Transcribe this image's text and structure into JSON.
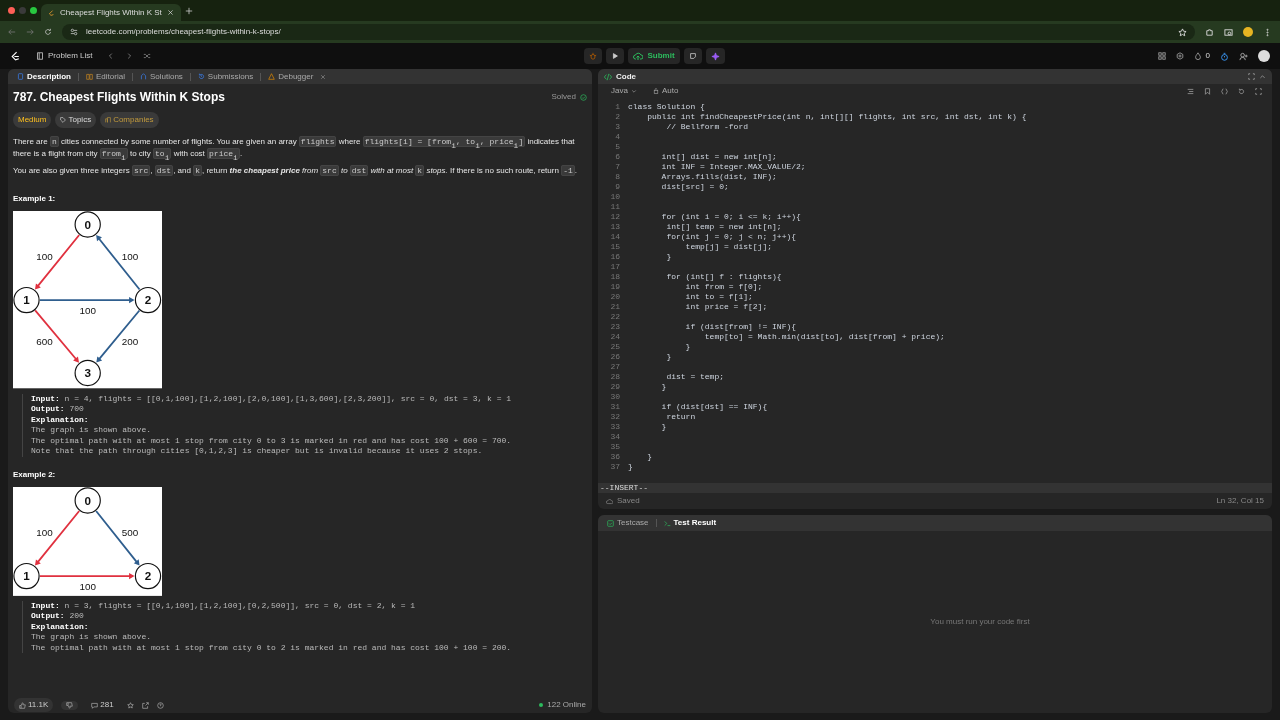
{
  "browser": {
    "tab_title": "Cheapest Flights Within K St",
    "url": "leetcode.com/problems/cheapest-flights-within-k-stops/"
  },
  "nav": {
    "problem_list": "Problem List",
    "submit": "Submit",
    "streak": "0"
  },
  "left_tabs": [
    {
      "label": "Description",
      "selected": true
    },
    {
      "label": "Editorial",
      "selected": false
    },
    {
      "label": "Solutions",
      "selected": false
    },
    {
      "label": "Submissions",
      "selected": false
    },
    {
      "label": "Debugger",
      "selected": false
    }
  ],
  "problem": {
    "title": "787. Cheapest Flights Within K Stops",
    "status": "Solved",
    "tags": [
      {
        "label": "Medium",
        "kind": "difficulty"
      },
      {
        "label": "Topics",
        "kind": "topics"
      },
      {
        "label": "Companies",
        "kind": "companies"
      }
    ],
    "paragraphs": [
      [
        {
          "kind": "text",
          "text": "There are "
        },
        {
          "kind": "code",
          "text": "n"
        },
        {
          "kind": "text",
          "text": " cities connected by some number of flights. You are given an array "
        },
        {
          "kind": "code",
          "text": "flights"
        },
        {
          "kind": "text",
          "text": " where "
        },
        {
          "kind": "code",
          "text": "flights[i] = [from$_{i}$, to$_{i}$, price$_{i}$]"
        },
        {
          "kind": "text",
          "text": " indicates that there is a flight from city "
        },
        {
          "kind": "code",
          "text": "from$_{i}$"
        },
        {
          "kind": "text",
          "text": " to city "
        },
        {
          "kind": "code",
          "text": "to$_{i}$"
        },
        {
          "kind": "text",
          "text": " with cost "
        },
        {
          "kind": "code",
          "text": "price$_{i}$"
        },
        {
          "kind": "text",
          "text": "."
        }
      ],
      [
        {
          "kind": "text",
          "text": "You are also given three integers "
        },
        {
          "kind": "code",
          "text": "src"
        },
        {
          "kind": "text",
          "text": ", "
        },
        {
          "kind": "code",
          "text": "dst"
        },
        {
          "kind": "text",
          "text": ", and "
        },
        {
          "kind": "code",
          "text": "k"
        },
        {
          "kind": "text",
          "text": ", return "
        },
        {
          "kind": "em",
          "text": "**the cheapest price** from "
        },
        {
          "kind": "code",
          "text": "src"
        },
        {
          "kind": "em",
          "text": " to "
        },
        {
          "kind": "code",
          "text": "dst"
        },
        {
          "kind": "em",
          "text": " with at most "
        },
        {
          "kind": "code",
          "text": "k"
        },
        {
          "kind": "em",
          "text": " stops."
        },
        {
          "kind": "text",
          "text": " If there is no such route, return "
        },
        {
          "kind": "code",
          "text": "-1"
        },
        {
          "kind": "text",
          "text": "."
        }
      ]
    ]
  },
  "examples": [
    {
      "heading": "Example 1:",
      "graph": {
        "kind": "diamond",
        "nodes": [
          "0",
          "1",
          "2",
          "3"
        ],
        "edges": [
          {
            "weight": "100",
            "color": "#e0313f"
          },
          {
            "weight": "100",
            "color": "#2f5e8e"
          },
          {
            "weight": "100",
            "color": "#2f5e8e"
          },
          {
            "weight": "600",
            "color": "#e0313f"
          },
          {
            "weight": "200",
            "color": "#2f5e8e"
          }
        ]
      },
      "lines": [
        "**Input:** n = 4, flights = [[0,1,100],[1,2,100],[2,0,100],[1,3,600],[2,3,200]], src = 0, dst = 3, k = 1",
        "**Output:** 700",
        "**Explanation:**",
        "The graph is shown above.",
        "The optimal path with at most 1 stop from city 0 to 3 is marked in red and has cost 100 + 600 = 700.",
        "Note that the path through cities [0,1,2,3] is cheaper but is invalid because it uses 2 stops."
      ]
    },
    {
      "heading": "Example 2:",
      "graph": {
        "kind": "triangle",
        "nodes": [
          "0",
          "1",
          "2"
        ],
        "edges": [
          {
            "weight": "100",
            "color": "#e0313f"
          },
          {
            "weight": "500",
            "color": "#2f5e8e"
          },
          {
            "weight": "100",
            "color": "#e0313f"
          }
        ]
      },
      "lines": [
        "**Input:** n = 3, flights = [[0,1,100],[1,2,100],[0,2,500]], src = 0, dst = 2, k = 1",
        "**Output:** 200",
        "**Explanation:**",
        "The graph is shown above.",
        "The optimal path with at most 1 stop from city 0 to 2 is marked in red and has cost 100 + 100 = 200."
      ]
    }
  ],
  "footer": {
    "likes": "11.1K",
    "comments": "281",
    "online": "122 Online"
  },
  "editor": {
    "title": "Code",
    "language": "Java",
    "mode": "Auto",
    "lines": [
      {
        "number": "1",
        "code": "class Solution {"
      },
      {
        "number": "2",
        "code": "    public int findCheapestPrice(int n, int[][] flights, int src, int dst, int k) {"
      },
      {
        "number": "3",
        "code": "        // Bellform -ford"
      },
      {
        "number": "4"
      },
      {
        "number": "5"
      },
      {
        "number": "6",
        "code": "       int[] dist = new int[n];"
      },
      {
        "number": "7",
        "code": "       int INF = Integer.MAX_VALUE/2;"
      },
      {
        "number": "8",
        "code": "       Arrays.fills(dist, INF);"
      },
      {
        "number": "9",
        "code": "       dist[src] = 0;"
      },
      {
        "number": "10"
      },
      {
        "number": "11"
      },
      {
        "number": "12",
        "code": "       for (int i = 0; i <= k; i++){"
      },
      {
        "number": "13",
        "code": "        int[] temp = new int[n];"
      },
      {
        "number": "14",
        "code": "        for(int j = 0; j < n; j++){"
      },
      {
        "number": "15",
        "code": "            temp[j] = dist[j];"
      },
      {
        "number": "16",
        "code": "        }"
      },
      {
        "number": "17"
      },
      {
        "number": "18",
        "code": "        for (int[] f : flights){"
      },
      {
        "number": "19",
        "code": "            int from = f[0];"
      },
      {
        "number": "20",
        "code": "            int to = f[1];"
      },
      {
        "number": "21",
        "code": "            int price = f[2];"
      },
      {
        "number": "22"
      },
      {
        "number": "23",
        "code": "            if (dist[from] != INF){"
      },
      {
        "number": "24",
        "code": "                temp[to] = Math.min(dist[to], dist[from] + price);"
      },
      {
        "number": "25",
        "code": "            }"
      },
      {
        "number": "26",
        "code": "        }"
      },
      {
        "number": "27"
      },
      {
        "number": "28",
        "code": "        dist = temp;"
      },
      {
        "number": "29",
        "code": "       }"
      },
      {
        "number": "30"
      },
      {
        "number": "31",
        "code": "       if (dist[dst] == INF){"
      },
      {
        "number": "32",
        "code": "        return"
      },
      {
        "number": "33",
        "code": "       }"
      },
      {
        "number": "34"
      },
      {
        "number": "35"
      },
      {
        "number": "36",
        "code": "    }"
      },
      {
        "number": "37",
        "code": "}"
      }
    ],
    "vim_mode": "--INSERT--",
    "save_status": "Saved",
    "cursor": "Ln 32, Col 15"
  },
  "results": {
    "tabs": [
      {
        "label": "Testcase",
        "selected": false
      },
      {
        "label": "Test Result",
        "selected": true
      }
    ],
    "message": "You must run your code first"
  }
}
